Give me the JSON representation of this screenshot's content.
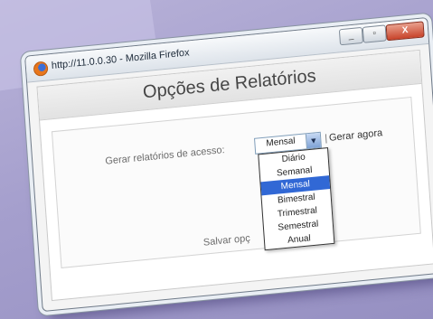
{
  "window": {
    "title": "http://11.0.0.30 - Mozilla Firefox",
    "buttons": {
      "minimize": "_",
      "maximize": "▫",
      "close": "X"
    }
  },
  "page": {
    "heading": "Opções de Relatórios",
    "generate_label": "Gerar relatórios de acesso:",
    "frequency_select": {
      "selected": "Mensal",
      "options": [
        "Diário",
        "Semanal",
        "Mensal",
        "Bimestral",
        "Trimestral",
        "Semestral",
        "Anual"
      ],
      "highlighted_index": 2
    },
    "generate_now_separator": "|",
    "generate_now_link": "Gerar agora",
    "save_label": "Salvar opç"
  },
  "colors": {
    "background": "#a59fcd",
    "selection": "#3168d5",
    "close_button": "#c8432a"
  }
}
